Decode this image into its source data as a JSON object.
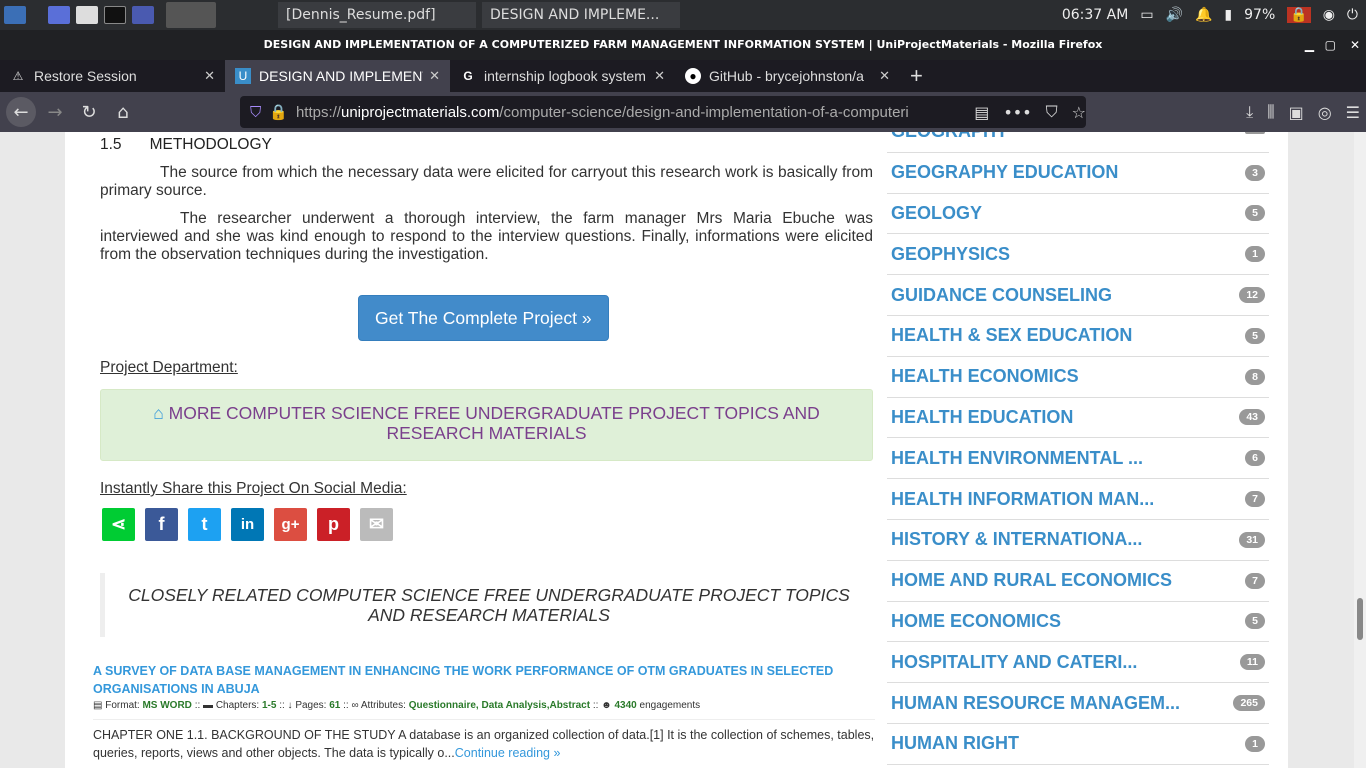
{
  "taskbar": {
    "windows": [
      "[Dennis_Resume.pdf]",
      "DESIGN AND IMPLEME..."
    ],
    "clock": "06:37 AM",
    "battery": "97%"
  },
  "window": {
    "title": "DESIGN AND IMPLEMENTATION OF A COMPUTERIZED FARM MANAGEMENT INFORMATION SYSTEM | UniProjectMaterials - Mozilla Firefox"
  },
  "tabs": [
    {
      "label": "Restore Session"
    },
    {
      "label": "DESIGN AND IMPLEMENTATION"
    },
    {
      "label": "internship logbook system"
    },
    {
      "label": "GitHub - brycejohnston/a"
    }
  ],
  "url": {
    "prefix": "https://",
    "domain": "uniprojectmaterials.com",
    "path": "/computer-science/design-and-implementation-of-a-computeri"
  },
  "article": {
    "heading_num": "1.5",
    "heading": "METHODOLOGY",
    "p1": "The source from which the necessary data were elicited for carryout this research work is basically from primary source.",
    "p2": "The researcher underwent a thorough interview, the farm manager Mrs Maria Ebuche was interviewed and she was kind enough to respond to the interview questions.  Finally, informations were elicited from the observation techniques during the investigation.",
    "cta": "Get The Complete Project »",
    "dept_label": "Project Department:",
    "dept_link": "MORE COMPUTER SCIENCE FREE UNDERGRADUATE PROJECT TOPICS AND RESEARCH MATERIALS",
    "share_label": "Instantly Share this Project On Social Media:",
    "related_heading": "CLOSELY RELATED COMPUTER SCIENCE FREE UNDERGRADUATE PROJECT TOPICS AND RESEARCH MATERIALS"
  },
  "related": {
    "title": "A SURVEY OF DATA BASE MANAGEMENT IN ENHANCING THE WORK PERFORMANCE OF OTM GRADUATES IN SELECTED ORGANISATIONS IN ABUJA",
    "format_label": "Format:",
    "format": "MS WORD",
    "chapters_label": "Chapters:",
    "chapters": "1-5",
    "pages_label": "Pages:",
    "pages": "61",
    "attr_label": "Attributes:",
    "attrs": "Questionnaire, Data Analysis,Abstract",
    "engagements": "4340",
    "engagements_label": "engagements",
    "summary": "CHAPTER ONE 1.1. BACKGROUND OF THE STUDY A database is an organized collection of data.[1] It is the collection of schemes, tables, queries, reports, views and other objects. The data is typically o...",
    "more": "Continue reading »"
  },
  "categories": [
    {
      "name": "GEOGRAPHY",
      "count": ""
    },
    {
      "name": "GEOGRAPHY EDUCATION",
      "count": "3"
    },
    {
      "name": "GEOLOGY",
      "count": "5"
    },
    {
      "name": "GEOPHYSICS",
      "count": "1"
    },
    {
      "name": "GUIDANCE COUNSELING",
      "count": "12"
    },
    {
      "name": "HEALTH & SEX EDUCATION",
      "count": "5"
    },
    {
      "name": "HEALTH ECONOMICS",
      "count": "8"
    },
    {
      "name": "HEALTH EDUCATION",
      "count": "43"
    },
    {
      "name": "HEALTH ENVIRONMENTAL ...",
      "count": "6"
    },
    {
      "name": "HEALTH INFORMATION MAN...",
      "count": "7"
    },
    {
      "name": "HISTORY & INTERNATIONA...",
      "count": "31"
    },
    {
      "name": "HOME AND RURAL ECONOMICS",
      "count": "7"
    },
    {
      "name": "HOME ECONOMICS",
      "count": "5"
    },
    {
      "name": "HOSPITALITY AND CATERI...",
      "count": "11"
    },
    {
      "name": "HUMAN RESOURCE MANAGEM...",
      "count": "265"
    },
    {
      "name": "HUMAN RIGHT",
      "count": "1"
    }
  ]
}
